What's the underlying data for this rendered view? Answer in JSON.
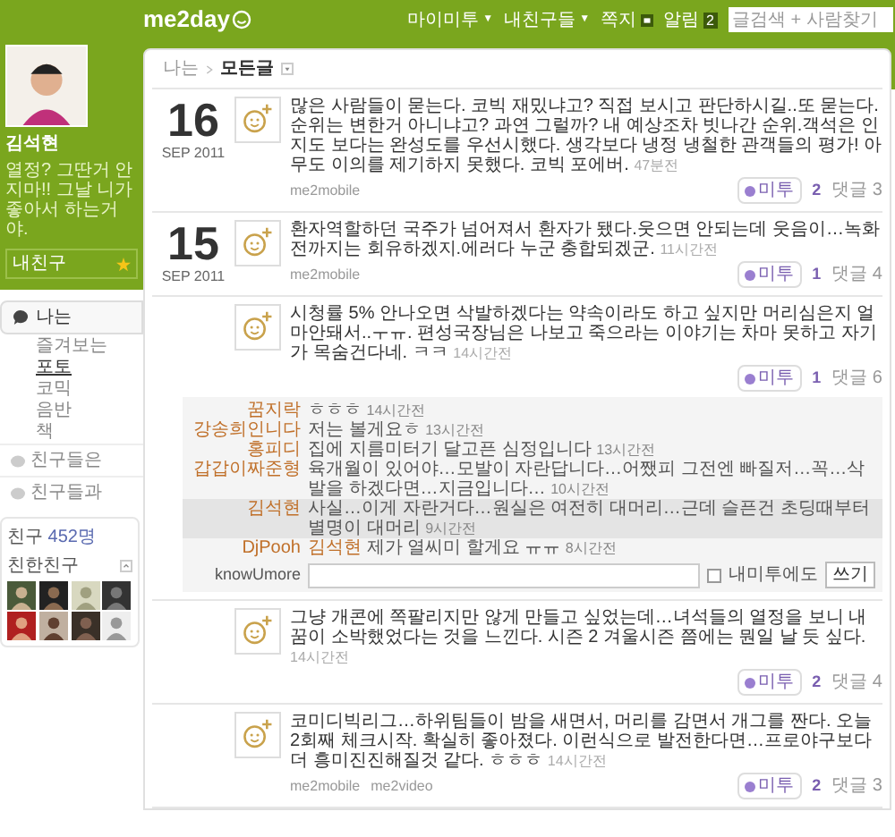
{
  "header": {
    "logo": "me2day",
    "menu": [
      {
        "label": "마이미투",
        "caret": "▼"
      },
      {
        "label": "내친구들",
        "caret": "▼"
      },
      {
        "label": "쪽지",
        "kind": "icon"
      },
      {
        "label": "알림",
        "badge": "2"
      }
    ],
    "search": {
      "placeholder": "글검색 + 사람찾기"
    }
  },
  "profile": {
    "name": "김석현",
    "status": "열정? 그딴거 안지마!! 그날 니가 좋아서 하는거야.",
    "friend_button": "내친구"
  },
  "nav": {
    "title": "나는",
    "items": [
      {
        "label": "즐겨보는",
        "selected": false
      },
      {
        "label": "포토",
        "selected": true
      },
      {
        "label": "코믹",
        "selected": false
      },
      {
        "label": "음반",
        "selected": false
      },
      {
        "label": "책",
        "selected": false
      }
    ],
    "links": [
      "친구들은",
      "친구들과"
    ]
  },
  "friends": {
    "label": "친구",
    "count": "452명",
    "close_label": "친한친구"
  },
  "breadcrumb": {
    "root": "나는",
    "current": "모든글"
  },
  "posts": [
    {
      "date": {
        "day": "16",
        "month_year": "SEP 2011"
      },
      "text": "많은 사람들이 묻는다. 코빅 재밌냐고? 직접 보시고 판단하시길..또 묻는다. 순위는 변한거 아니냐고? 과연 그럴까? 내 예상조차 빗나간 순위.객석은 인지도 보다는 완성도를 우선시했다. 생각보다 냉정 냉철한 관객들의 평가! 아무도 이의를 제기하지 못했다. 코빅 포에버.",
      "time": "47분전",
      "sources": [
        "me2mobile"
      ],
      "metoo_label": "미투",
      "metoo_count": "2",
      "comments_label": "댓글 3"
    },
    {
      "date": {
        "day": "15",
        "month_year": "SEP 2011"
      },
      "text": "환자역할하던 국주가 넘어져서 환자가 됐다.웃으면 안되는데 웃음이…녹화전까지는 회유하겠지.에러다 누군 충합되겠군.",
      "time": "11시간전",
      "sources": [
        "me2mobile"
      ],
      "metoo_label": "미투",
      "metoo_count": "1",
      "comments_label": "댓글 4"
    },
    {
      "text": "시청률 5% 안나오면 삭발하겠다는 약속이라도 하고 싶지만 머리심은지 얼마안돼서..ㅜㅠ. 편성국장님은 나보고 죽으라는 이야기는 차마 못하고 자기가 목숨건다네. ㅋㅋ",
      "time": "14시간전",
      "metoo_label": "미투",
      "metoo_count": "1",
      "comments_label": "댓글 6",
      "comments": [
        {
          "author": "꿈지락",
          "text": "ㅎㅎㅎ",
          "time": "14시간전",
          "highlighted": false
        },
        {
          "author": "강송희인니다",
          "text": "저는 볼게요ㅎ",
          "time": "13시간전",
          "highlighted": false
        },
        {
          "author": "홍피디",
          "text": "집에 지름미터기 달고픈 심정입니다",
          "time": "13시간전",
          "highlighted": false
        },
        {
          "author": "갑갑이짜준형",
          "text": "육개월이 있어야…모발이 자란답니다…어쨌피 그전엔 빠질저…꼭…삭발을 하겠다면…지금입니다…",
          "time": "10시간전",
          "highlighted": false
        },
        {
          "author": "김석현",
          "text": "사실…이게 자란거다…원실은 여전히 대머리…근데 슬픈건 초딩때부터 별명이 대머리",
          "time": "9시간전",
          "highlighted": true
        },
        {
          "author": "DjPooh",
          "mention": "김석현",
          "text": "제가 열씨미 할게요 ㅠㅠ",
          "time": "8시간전",
          "highlighted": false
        }
      ],
      "comment_form": {
        "user": "knowUmore",
        "checkbox_label": "내미투에도",
        "checked": false,
        "submit": "쓰기"
      }
    },
    {
      "text": "그냥 개콘에 쪽팔리지만 않게 만들고 싶었는데…녀석들의 열정을 보니 내 꿈이 소박했었다는 것을 느낀다. 시즌 2 겨울시즌 쯤에는 뭔일 날 듯 싶다.",
      "time": "14시간전",
      "metoo_label": "미투",
      "metoo_count": "2",
      "comments_label": "댓글 4"
    },
    {
      "text": "코미디빅리그…하위팀들이 밤을 새면서, 머리를 감면서 개그를 짠다. 오늘 2회째 체크시작. 확실히 좋아졌다. 이런식으로 발전한다면…프로야구보다 더 흥미진진해질것 같다. ㅎㅎㅎ",
      "time": "14시간전",
      "sources": [
        "me2mobile",
        "me2video"
      ],
      "metoo_label": "미투",
      "metoo_count": "2",
      "comments_label": "댓글 3"
    }
  ]
}
